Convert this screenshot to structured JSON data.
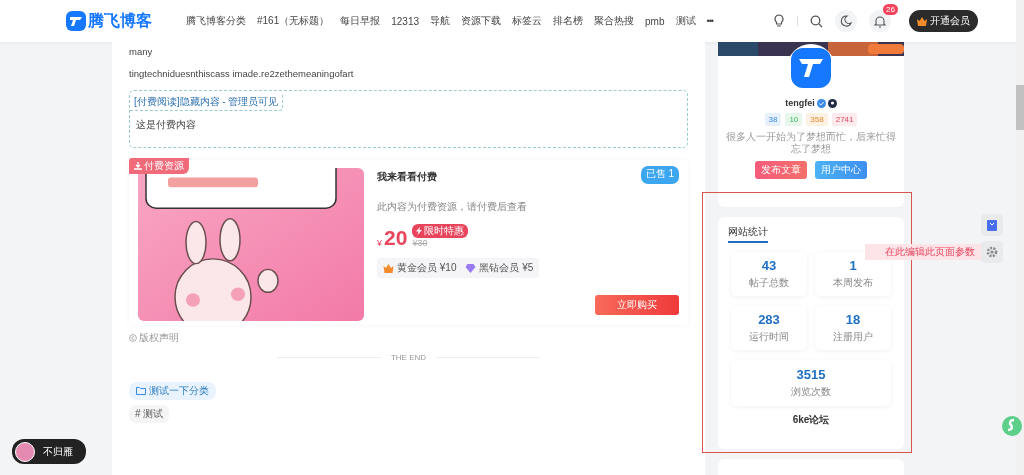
{
  "header": {
    "logo_text": "腾飞博客",
    "nav": [
      "腾飞博客分类",
      "#161（无标题）",
      "每日早报",
      "12313",
      "导航",
      "资源下载",
      "标签云",
      "排名榜",
      "聚合热搜",
      "pmb",
      "测试"
    ],
    "more": "•••",
    "notification_count": "26",
    "vip_button": "开通会员"
  },
  "article": {
    "paragraphs": [
      "many",
      "tingtechniduesnthiscass imade.re2zethemeaningofart"
    ],
    "hidden_box": {
      "label": "[付费阅读]隐藏内容 - 管理员可见",
      "content": "这是付费内容"
    },
    "product": {
      "badge": "付费资源",
      "title": "我来看看付费",
      "sold": "已售 1",
      "description": "此内容为付费资源，请付费后查看",
      "currency": "¥",
      "price": "20",
      "promo": "限时特惠",
      "original_price": "¥30",
      "member_prices": [
        {
          "kind": "gold",
          "label": "黄金会员",
          "price": "¥10"
        },
        {
          "kind": "diamond",
          "label": "黑钻会员",
          "price": "¥5"
        }
      ],
      "buy_button": "立即购买"
    },
    "copyright": "版权声明",
    "end_text": "THE END",
    "category": "测试一下分类",
    "tag": "# 测试"
  },
  "profile": {
    "name": "tengfei",
    "stats": [
      {
        "kind": "posts",
        "value": "38"
      },
      {
        "kind": "comments",
        "value": "10"
      },
      {
        "kind": "likes",
        "value": "358"
      },
      {
        "kind": "views",
        "value": "2741"
      }
    ],
    "motto": "很多人一开始为了梦想而忙，后来忙得忘了梦想",
    "buttons": [
      {
        "kind": "publish",
        "label": "发布文章"
      },
      {
        "kind": "center",
        "label": "用户中心"
      }
    ]
  },
  "site_stats": {
    "title": "网站统计",
    "items": [
      {
        "value": "43",
        "label": "帖子总数"
      },
      {
        "value": "1",
        "label": "本周发布"
      },
      {
        "value": "283",
        "label": "运行时间"
      },
      {
        "value": "18",
        "label": "注册用户"
      },
      {
        "value": "3515",
        "label": "浏览次数"
      }
    ],
    "footer": "6ke论坛"
  },
  "tooltip": "在此编辑此页面参数",
  "player": {
    "title": "不归雁"
  }
}
